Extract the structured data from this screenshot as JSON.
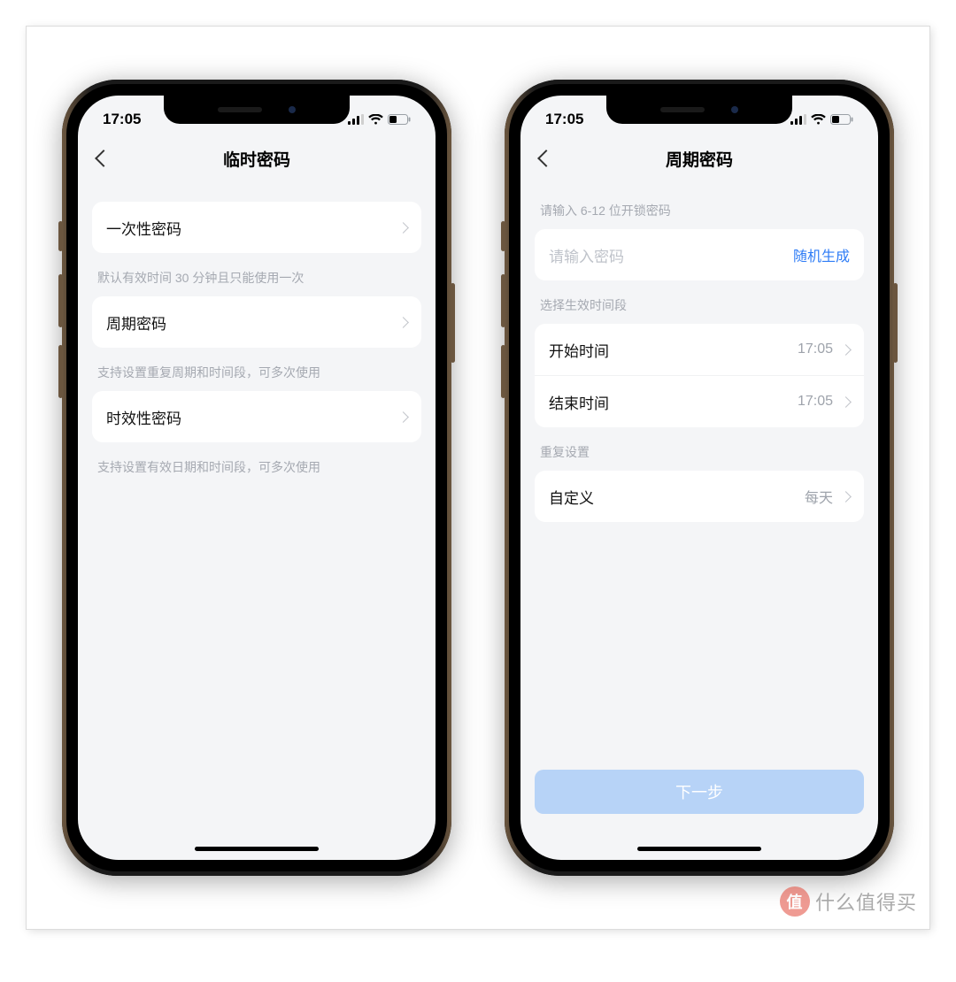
{
  "watermark": {
    "badge": "值",
    "text": "什么值得买"
  },
  "statusbar": {
    "time": "17:05"
  },
  "left_phone": {
    "nav_title": "临时密码",
    "items": [
      {
        "label": "一次性密码",
        "hint": "默认有效时间 30 分钟且只能使用一次"
      },
      {
        "label": "周期密码",
        "hint": "支持设置重复周期和时间段，可多次使用"
      },
      {
        "label": "时效性密码",
        "hint": "支持设置有效日期和时间段，可多次使用"
      }
    ]
  },
  "right_phone": {
    "nav_title": "周期密码",
    "pw_hint": "请输入 6-12 位开锁密码",
    "pw_placeholder": "请输入密码",
    "pw_random": "随机生成",
    "period_hint": "选择生效时间段",
    "start_label": "开始时间",
    "start_value": "17:05",
    "end_label": "结束时间",
    "end_value": "17:05",
    "repeat_hint": "重复设置",
    "custom_label": "自定义",
    "custom_value": "每天",
    "next_btn": "下一步"
  }
}
